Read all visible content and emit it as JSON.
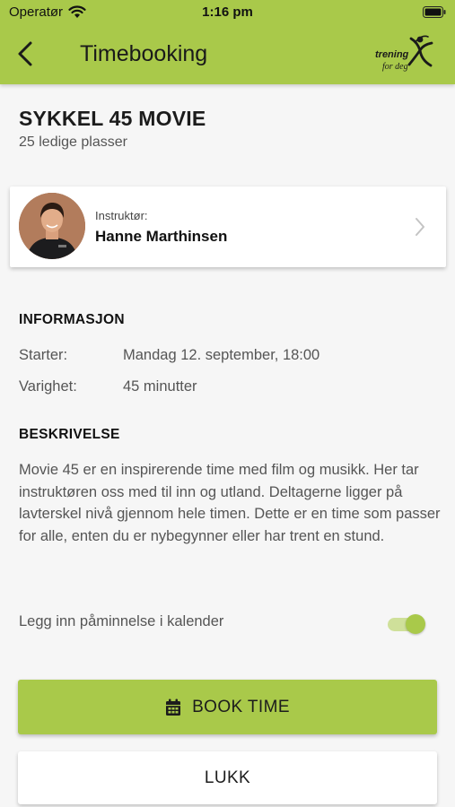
{
  "status_bar": {
    "carrier": "Operatør",
    "time": "1:16 pm"
  },
  "nav": {
    "title": "Timebooking",
    "back_icon": "chevron-left-icon",
    "logo_text_top": "trening",
    "logo_text_bottom": "for deg",
    "accent_color": "#a9c94a"
  },
  "class": {
    "name": "SYKKEL 45 MOVIE",
    "spots": "25 ledige plasser"
  },
  "instructor": {
    "label": "Instruktør:",
    "name": "Hanne Marthinsen"
  },
  "info": {
    "heading": "INFORMASJON",
    "rows": [
      {
        "label": "Starter:",
        "value": "Mandag 12. september, 18:00"
      },
      {
        "label": "Varighet:",
        "value": "45 minutter"
      }
    ]
  },
  "description": {
    "heading": "BESKRIVELSE",
    "text": "Movie 45 er en inspirerende time med film og musikk. Her tar instruktøren oss med til inn og utland. Deltagerne ligger på lavterskel nivå gjennom hele timen. Dette er en time som passer for alle, enten du er nybegynner eller har trent en stund."
  },
  "reminder": {
    "label": "Legg inn påminnelse i kalender",
    "enabled": true
  },
  "actions": {
    "book_label": "BOOK TIME",
    "close_label": "LUKK"
  }
}
